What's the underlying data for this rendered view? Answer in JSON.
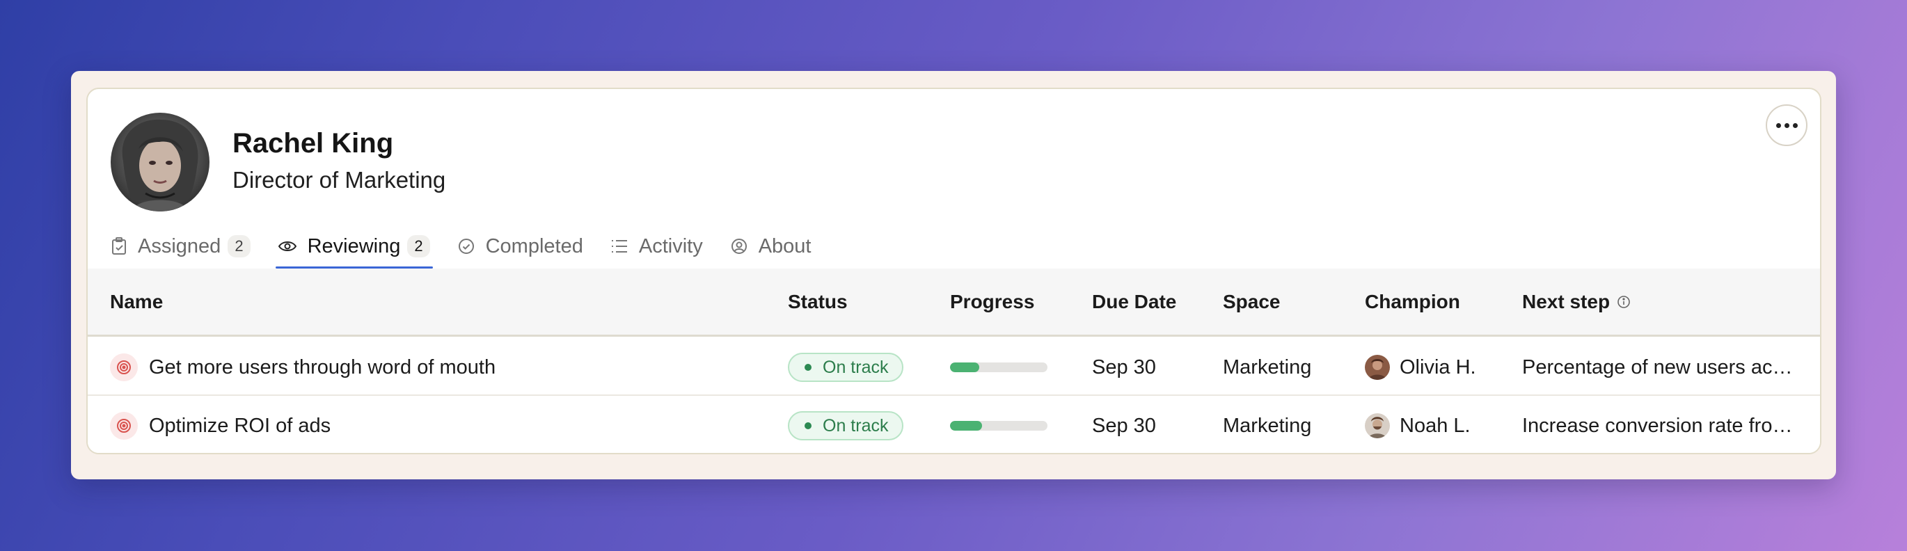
{
  "profile": {
    "name": "Rachel King",
    "title": "Director of Marketing"
  },
  "tabs": [
    {
      "label": "Assigned",
      "count": "2",
      "icon": "clipboard-icon",
      "active": false
    },
    {
      "label": "Reviewing",
      "count": "2",
      "icon": "eye-icon",
      "active": true
    },
    {
      "label": "Completed",
      "icon": "check-circle-icon",
      "active": false
    },
    {
      "label": "Activity",
      "icon": "list-icon",
      "active": false
    },
    {
      "label": "About",
      "icon": "user-circle-icon",
      "active": false
    }
  ],
  "table": {
    "columns": [
      "Name",
      "Status",
      "Progress",
      "Due Date",
      "Space",
      "Champion",
      "Next step"
    ],
    "rows": [
      {
        "name": "Get more users through word of mouth",
        "status": "On track",
        "progress": 0.3,
        "due": "Sep 30",
        "space": "Marketing",
        "champion": "Olivia H.",
        "next_step": "Percentage of new users acquired through referrals"
      },
      {
        "name": "Optimize ROI of ads",
        "status": "On track",
        "progress": 0.33,
        "due": "Sep 30",
        "space": "Marketing",
        "champion": "Noah L.",
        "next_step": "Increase conversion rate from ad clicks"
      }
    ]
  },
  "colors": {
    "accent": "#3a66d6",
    "status_green": "#2c7d4b",
    "progress_fill": "#4bb272"
  }
}
